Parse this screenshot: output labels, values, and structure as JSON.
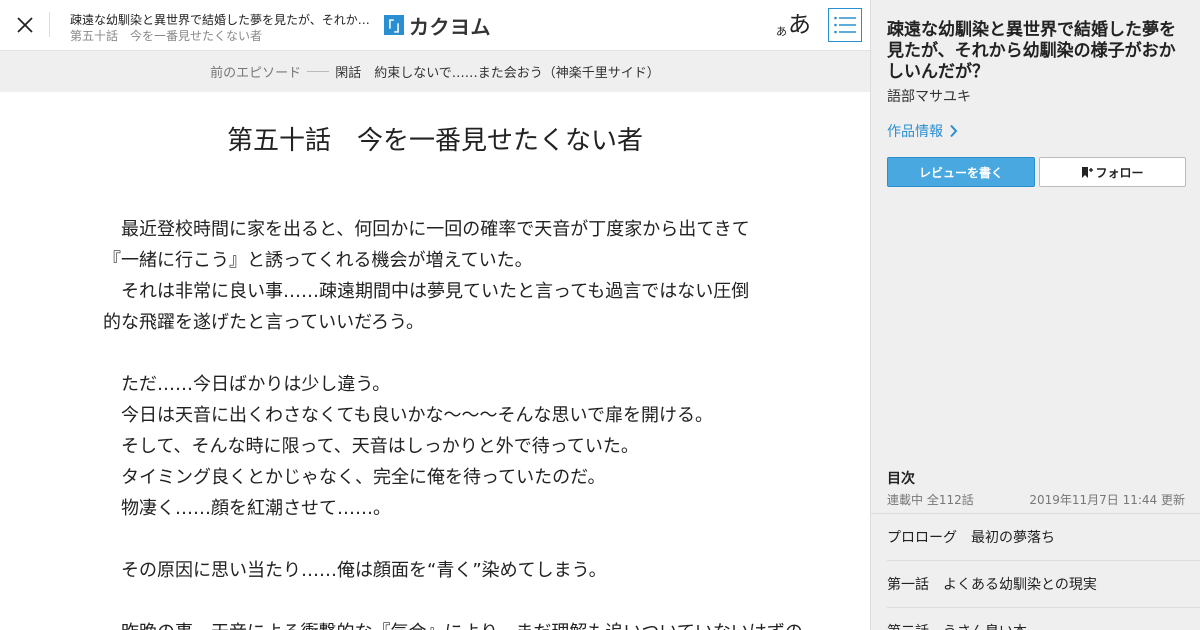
{
  "header": {
    "work_title": "疎遠な幼馴染と異世界で結婚した夢を見たが、それから幼馴染の様子がおかしいんだが？",
    "episode_title": "第五十話　今を一番見せたくない者",
    "logo_mark": "「」",
    "logo_text": "カクヨム",
    "font_size_small": "あ",
    "font_size_large": "あ",
    "icons": {
      "close": "close-icon",
      "toc": "list-icon"
    },
    "accent_color": "#2a8fd0"
  },
  "prev_episode": {
    "label": "前のエピソード",
    "title": "閑話　約束しないで……また会おう（神楽千里サイド）"
  },
  "chapter": {
    "title": "第五十話　今を一番見せたくない者",
    "paragraphs": [
      "　最近登校時間に家を出ると、何回かに一回の確率で天音が丁度家から出てきて",
      "『一緒に行こう』と誘ってくれる機会が増えていた。",
      "　それは非常に良い事……疎遠期間中は夢見ていたと言っても過言ではない圧倒",
      "的な飛躍を遂げたと言っていいだろう。",
      "",
      "　ただ……今日ばかりは少し違う。",
      "　今日は天音に出くわさなくても良いかな～～～そんな思いで扉を開ける。",
      "　そして、そんな時に限って、天音はしっかりと外で待っていた。",
      "　タイミング良くとかじゃなく、完全に俺を待っていたのだ。",
      "　物凄く……顔を紅潮させて……。",
      "",
      "　その原因に思い当たり……俺は顔面を“青く”染めてしまう。",
      "",
      "　昨晩の事、天音による衝撃的な『気合』により、まだ理解も追いついていないはずの"
    ]
  },
  "sidebar": {
    "title": "疎遠な幼馴染と異世界で結婚した夢を見たが、それから幼馴染の様子がおかしいんだが？",
    "author": "語部マサユキ",
    "work_info": "作品情報",
    "review_button": "レビューを書く",
    "follow_button": "フォロー",
    "toc": {
      "heading": "目次",
      "status": "連載中 全112話",
      "updated": "2019年11月7日 11:44 更新",
      "items": [
        "プロローグ　最初の夢落ち",
        "第一話　よくある幼馴染との現実",
        "第二話　うさん臭い本"
      ]
    }
  }
}
